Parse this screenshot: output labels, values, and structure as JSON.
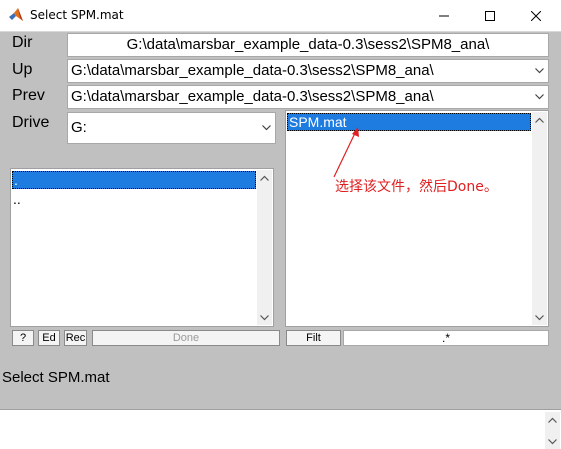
{
  "window": {
    "title": "Select SPM.mat"
  },
  "labels": {
    "dir": "Dir",
    "up": "Up",
    "prev": "Prev",
    "drive": "Drive"
  },
  "fields": {
    "dir_value": "G:\\data\\marsbar_example_data-0.3\\sess2\\SPM8_ana\\",
    "up_value": "G:\\data\\marsbar_example_data-0.3\\sess2\\SPM8_ana\\",
    "prev_value": "G:\\data\\marsbar_example_data-0.3\\sess2\\SPM8_ana\\",
    "drive_value": "G:"
  },
  "dir_list": {
    "items": [
      ".",
      ".."
    ],
    "selected_index": 0
  },
  "file_list": {
    "items": [
      "SPM.mat"
    ],
    "selected_index": 0
  },
  "buttons": {
    "help": "?",
    "edit": "Ed",
    "rec": "Rec",
    "done": "Done",
    "filt": "Filt"
  },
  "filter": {
    "value": ".*"
  },
  "annotation": {
    "text": "选择该文件，然后Done。",
    "color": "#e02020"
  },
  "status": {
    "text": "Select SPM.mat"
  },
  "colors": {
    "selection": "#1e7be0",
    "background": "#c0c0c0"
  }
}
